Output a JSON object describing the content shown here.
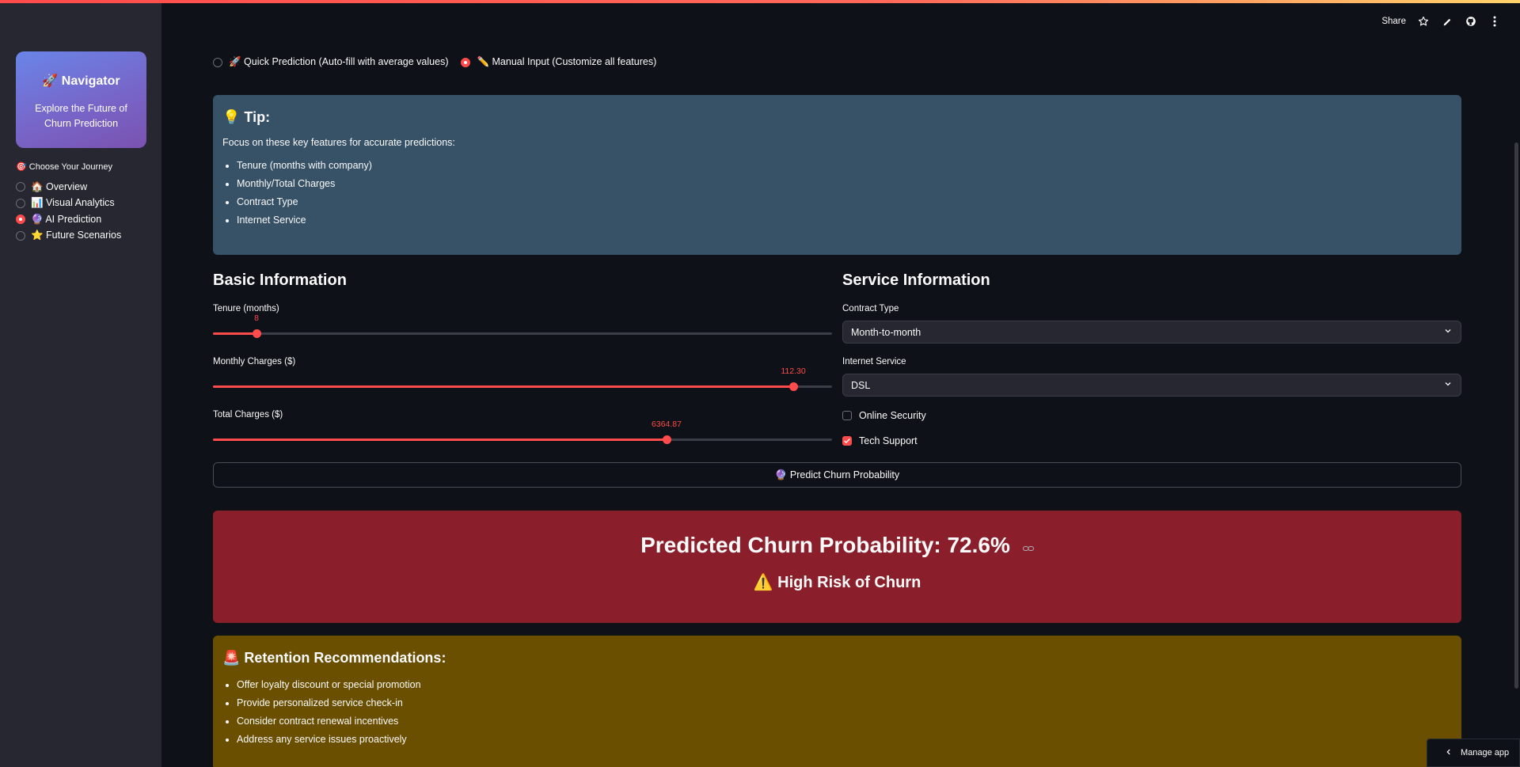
{
  "header": {
    "share_label": "Share",
    "icons": [
      "star-icon",
      "pencil-icon",
      "github-icon",
      "more-vertical-icon"
    ]
  },
  "sidebar": {
    "card_title": "🚀 Navigator",
    "card_subtitle": "Explore the Future of Churn Prediction",
    "journey_label": "🎯 Choose Your Journey",
    "items": [
      {
        "label": "🏠 Overview",
        "selected": false
      },
      {
        "label": "📊 Visual Analytics",
        "selected": false
      },
      {
        "label": "🔮 AI Prediction",
        "selected": true
      },
      {
        "label": "⭐ Future Scenarios",
        "selected": false
      }
    ]
  },
  "mode": {
    "options": [
      {
        "label": "🚀 Quick Prediction (Auto-fill with average values)",
        "selected": false
      },
      {
        "label": "✏️ Manual Input (Customize all features)",
        "selected": true
      }
    ]
  },
  "tip": {
    "title": "💡 Tip:",
    "intro": "Focus on these key features for accurate predictions:",
    "items": [
      "Tenure (months with company)",
      "Monthly/Total Charges",
      "Contract Type",
      "Internet Service"
    ]
  },
  "basic": {
    "title": "Basic Information",
    "tenure": {
      "label": "Tenure (months)",
      "value": "8",
      "fraction": 0.07
    },
    "monthly": {
      "label": "Monthly Charges ($)",
      "value": "112.30",
      "fraction": 0.937
    },
    "total": {
      "label": "Total Charges ($)",
      "value": "6364.87",
      "fraction": 0.733
    }
  },
  "service": {
    "title": "Service Information",
    "contract": {
      "label": "Contract Type",
      "value": "Month-to-month"
    },
    "internet": {
      "label": "Internet Service",
      "value": "DSL"
    },
    "online_security": {
      "label": "Online Security",
      "checked": false
    },
    "tech_support": {
      "label": "Tech Support",
      "checked": true
    }
  },
  "predict_button": "🔮 Predict Churn Probability",
  "result": {
    "probability_text": "Predicted Churn Probability: 72.6%",
    "risk_text": "⚠️ High Risk of Churn",
    "color": "#8b1e2b"
  },
  "retention": {
    "title": "🚨 Retention Recommendations:",
    "items": [
      "Offer loyalty discount or special promotion",
      "Provide personalized service check-in",
      "Consider contract renewal incentives",
      "Address any service issues proactively"
    ]
  },
  "manage_app": "Manage app",
  "colors": {
    "accent": "#ff4b4b",
    "tip_bg": "#375167",
    "retention_bg": "#6a4f00",
    "sidebar_bg": "#262730"
  }
}
